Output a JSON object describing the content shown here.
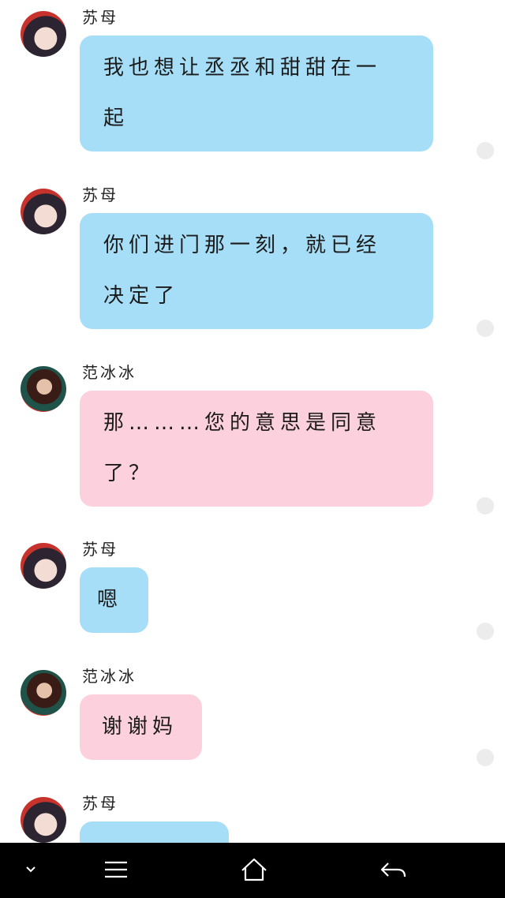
{
  "messages": [
    {
      "sender": "苏母",
      "side": "blue",
      "lines": [
        "我也想让丞丞和甜甜在一",
        "起"
      ]
    },
    {
      "sender": "苏母",
      "side": "blue",
      "lines": [
        "你们进门那一刻，就已经",
        "决定了"
      ]
    },
    {
      "sender": "范冰冰",
      "side": "pink",
      "lines": [
        "那………您的意思是同意",
        "了？"
      ]
    },
    {
      "sender": "苏母",
      "side": "blue",
      "lines": [
        "嗯"
      ]
    },
    {
      "sender": "范冰冰",
      "side": "pink",
      "lines": [
        "谢谢妈"
      ]
    },
    {
      "sender": "苏母",
      "side": "blue",
      "lines": [
        ""
      ]
    }
  ],
  "colors": {
    "blue_bubble": "#a6def7",
    "pink_bubble": "#fdd0dd",
    "nav_background": "#000000"
  },
  "navbar": {
    "icons": [
      "chevron-down-icon",
      "menu-icon",
      "home-icon",
      "back-icon"
    ]
  }
}
